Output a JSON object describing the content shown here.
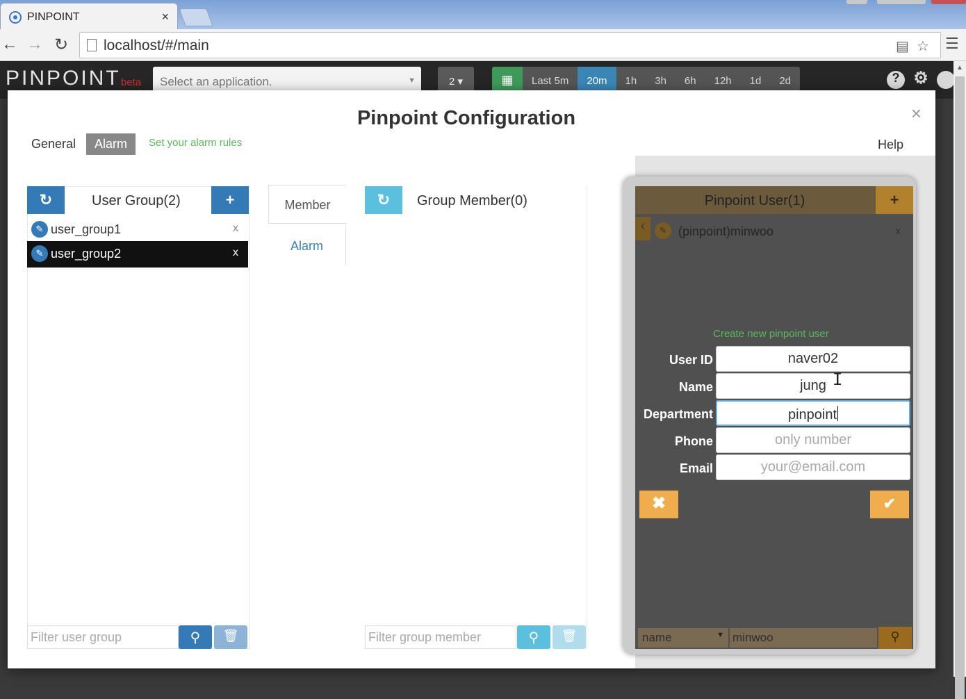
{
  "browser": {
    "tab_title": "PINPOINT",
    "tab_close": "×",
    "url": "localhost/#/main"
  },
  "app": {
    "logo": "PINPOINT",
    "logo_badge": "beta",
    "app_select_placeholder": "Select an application.",
    "depth_value": "2",
    "time_ranges": [
      "Last 5m",
      "20m",
      "1h",
      "3h",
      "6h",
      "12h",
      "1d",
      "2d"
    ],
    "active_range": "20m"
  },
  "modal": {
    "title": "Pinpoint Configuration",
    "close": "×",
    "tabs": [
      "General",
      "Alarm"
    ],
    "active_tab": "Alarm",
    "alarm_hint": "Set your alarm rules",
    "help": "Help"
  },
  "user_groups": {
    "title": "User Group(2)",
    "items": [
      {
        "name": "user_group1",
        "selected": false
      },
      {
        "name": "user_group2",
        "selected": true
      }
    ],
    "remove_glyph": "x",
    "filter_placeholder": "Filter user group"
  },
  "side_tabs": {
    "member": "Member",
    "alarm": "Alarm"
  },
  "group_members": {
    "title": "Group Member(0)",
    "filter_placeholder": "Filter group member"
  },
  "pinpoint_users": {
    "title": "Pinpoint User(1)",
    "items": [
      {
        "name": "(pinpoint)minwoo"
      }
    ],
    "remove_glyph": "x",
    "create_label": "Create new pinpoint user",
    "form": {
      "user_id_label": "User ID",
      "user_id_value": "naver02",
      "name_label": "Name",
      "name_value": "jung",
      "department_label": "Department",
      "department_value": "pinpoint",
      "phone_label": "Phone",
      "phone_placeholder": "only number",
      "email_label": "Email",
      "email_placeholder": "your@email.com"
    },
    "filter_field": "name",
    "filter_value": "minwoo"
  },
  "icons": {
    "accent": "#337ab7",
    "success_text": "#5cb85c",
    "warning": "#f0ad4e"
  }
}
